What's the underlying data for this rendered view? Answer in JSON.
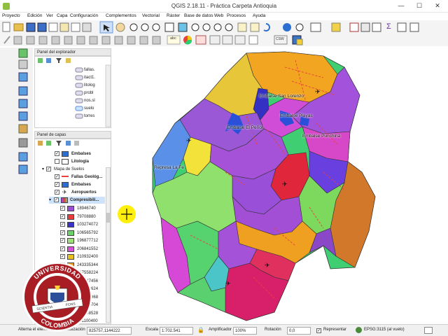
{
  "window": {
    "title": "QGIS 2.18.11 - Práctica Carpeta Antioquia",
    "minimize": "—",
    "maximize": "☐",
    "close": "✕"
  },
  "menu": [
    "Proyecto",
    "Edición",
    "Ver",
    "Capa",
    "Configuración",
    "Complementos",
    "Vectorial",
    "Ráster",
    "Base de datos",
    "Web",
    "Procesos",
    "Ayuda"
  ],
  "toolbar": {
    "abc_label": "abc",
    "csw_label": "CSW",
    "sigma": "Σ"
  },
  "browser_panel": {
    "title": "Panel del explorador",
    "items": [
      "fallas.",
      "itact1.",
      "litolog",
      "probl",
      "nos.sl",
      "suelo",
      "torres"
    ]
  },
  "layers_panel": {
    "title": "Panel de capas",
    "layers": [
      {
        "label": "Embalses",
        "checked": true,
        "bold": true,
        "color": "#2a6fd1"
      },
      {
        "label": "Litologia",
        "checked": false,
        "bold": true,
        "color": "#ffffff"
      },
      {
        "label": "Mapa de Suelos",
        "checked": true,
        "bold": false,
        "group": true
      },
      {
        "label": "Fallas Geológ...",
        "checked": true,
        "bold": true,
        "color": "#e8403a"
      },
      {
        "label": "Embalses",
        "checked": true,
        "bold": true,
        "color": "#2a6fd1"
      },
      {
        "label": "Aeropuertos",
        "checked": true,
        "bold": true,
        "color": "#222222"
      },
      {
        "label": "Compresibili...",
        "checked": true,
        "bold": true,
        "selected": true
      }
    ],
    "classes": [
      {
        "label": "18946740",
        "color": "#9b4fd6"
      },
      {
        "label": "79708880",
        "color": "#ea3c3c"
      },
      {
        "label": "103274072",
        "color": "#3a33c8"
      },
      {
        "label": "106565792",
        "color": "#6bd26b"
      },
      {
        "label": "196877712",
        "color": "#9fe07a"
      },
      {
        "label": "206841552",
        "color": "#d84fd8"
      },
      {
        "label": "210932400",
        "color": "#e8c020"
      },
      {
        "label": "243335344",
        "color": "#f0a020"
      },
      {
        "label": "247558224",
        "color": "#d8346a"
      },
      {
        "label": "281447456",
        "color": "#44c4c4"
      },
      {
        "label": "320862624",
        "color": "#d81f5a"
      },
      {
        "label": "350898968",
        "color": "#f7df3e"
      },
      {
        "label": "380016704",
        "color": "#5ed6a0"
      },
      {
        "label": "438898528",
        "color": "#c27a30"
      },
      {
        "label": "581100400",
        "color": "#a24ae0"
      }
    ]
  },
  "map": {
    "labels": [
      "Embalse San Lorenzo",
      "Embalse Playas",
      "Embalse El Peñol",
      "Embalse Punchiná",
      "Represa La Fe"
    ]
  },
  "status": {
    "coord_label": "Alterna el elemento de visualización",
    "coord_value": "825757,1144222",
    "scale_label": "Escala",
    "scale_value": "1:702.541",
    "magnifier_label": "Amplificador",
    "magnifier_value": "100%",
    "rotation_label": "Rotación",
    "rotation_value": "0,0",
    "render_label": "Representar",
    "epsg_label": "EPSG:3115 (al vuelo)"
  },
  "seal": {
    "top_text": "UNIVERSIDAD",
    "bottom_text": "COLOMBIA",
    "ribbon_left": "SCIENTIA",
    "ribbon_right": "FONS"
  }
}
